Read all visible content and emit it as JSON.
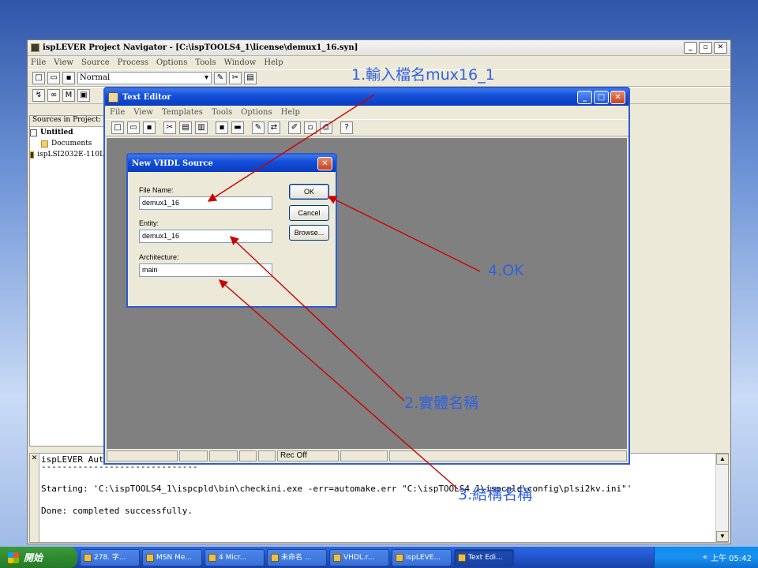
{
  "navigator": {
    "title": "ispLEVER Project Navigator - [C:\\ispTOOLS4_1\\license\\demux1_16.syn]",
    "menu": [
      "File",
      "View",
      "Source",
      "Process",
      "Options",
      "Tools",
      "Window",
      "Help"
    ],
    "combo_value": "Normal",
    "sources_header": "Sources in Project:",
    "tree": [
      "Untitled",
      "Documents",
      "ispLSI2032E-110L"
    ],
    "log_title": "ispLEVER Aut",
    "log_lines": "------------------------------\n\nStarting: 'C:\\ispTOOLS4_1\\ispcpld\\bin\\checkini.exe -err=automake.err \"C:\\ispTOOLS4_1\\ispcpld\\config\\plsi2kv.ini\"'\n\nDone: completed successfully."
  },
  "text_editor": {
    "title": "Text Editor",
    "menu": [
      "File",
      "View",
      "Templates",
      "Tools",
      "Options",
      "Help"
    ],
    "status_rec": "Rec Off"
  },
  "dialog": {
    "title": "New VHDL Source",
    "file_name_label": "File Name:",
    "file_name_value": "demux1_16",
    "entity_label": "Entity:",
    "entity_value": "demux1_16",
    "architecture_label": "Architecture:",
    "architecture_value": "main",
    "ok_label": "OK",
    "cancel_label": "Cancel",
    "browse_label": "Browse..."
  },
  "annotations": {
    "note1": "1.輸入檔名mux16_1",
    "note2": "2.實體名稱",
    "note3": "3.結構名稱",
    "note4": "4.OK",
    "color": "#2f62e0",
    "arrow_color": "#cc0000"
  },
  "taskbar": {
    "start": "開始",
    "tasks": [
      "278. 字...",
      "MSN Me...",
      "4 Micr...",
      "未命名 ...",
      "VHDL.r...",
      "ispLEVE...",
      "Text Edi..."
    ],
    "clock": "上午 05:42"
  }
}
